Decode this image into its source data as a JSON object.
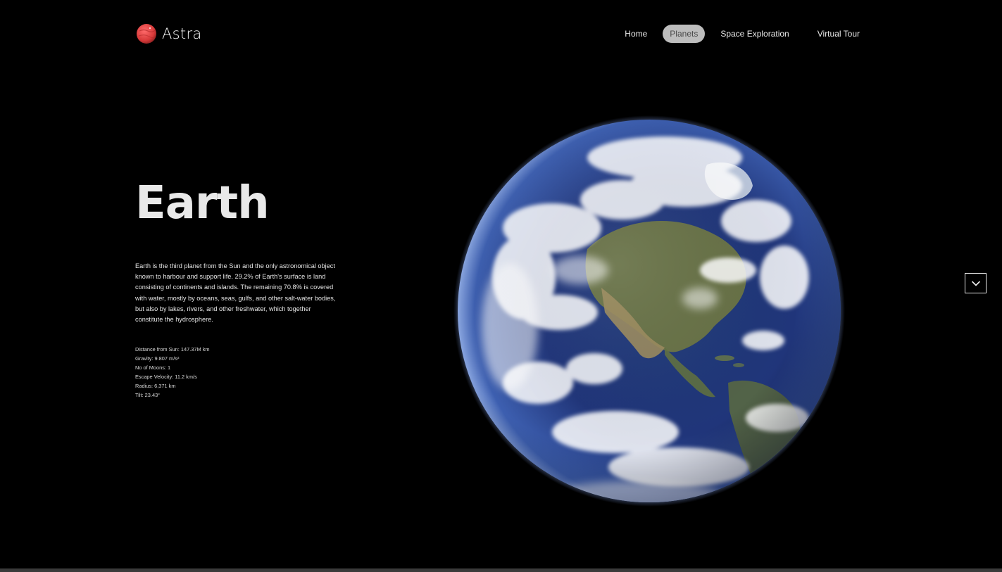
{
  "brand": {
    "name": "Astra",
    "logo_icon": "red-planet-icon",
    "accent": "#e04a4a"
  },
  "nav": {
    "items": [
      {
        "label": "Home",
        "active": false
      },
      {
        "label": "Planets",
        "active": true
      },
      {
        "label": "Space Exploration",
        "active": false
      },
      {
        "label": "Virtual Tour",
        "active": false
      }
    ]
  },
  "planet": {
    "name": "Earth",
    "description": "Earth is the third planet from the Sun and the only astronomical object known to harbour and support life. 29.2% of Earth's surface is land consisting of continents and islands. The remaining 70.8% is covered with water, mostly by oceans, seas, gulfs, and other salt-water bodies, but also by lakes, rivers, and other freshwater, which together constitute the hydrosphere.",
    "stats": [
      "Distance from Sun: 147.37M km",
      "Gravity: 9.807 m/s²",
      "No of Moons: 1",
      "Escape Velocity: 11.2 km/s",
      "Radius: 6,371 km",
      "Tilt: 23.43°"
    ],
    "image_icon": "earth-globe-image"
  },
  "scroll_button": {
    "icon": "chevron-down-icon"
  }
}
